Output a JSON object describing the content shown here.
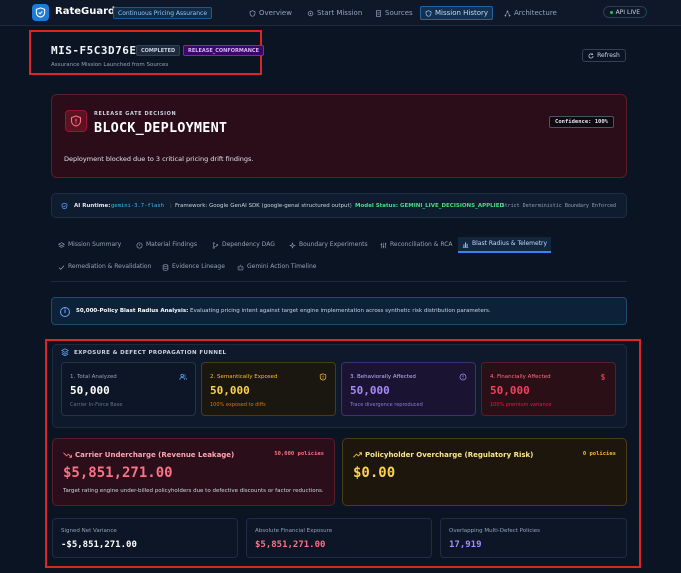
{
  "brand": {
    "name": "RateGuard",
    "ai": "AI",
    "tag": "Continuous Pricing Assurance"
  },
  "nav": [
    {
      "label": "Overview",
      "icon": "shield-icon"
    },
    {
      "label": "Start Mission",
      "icon": "gear-icon"
    },
    {
      "label": "Sources",
      "icon": "document-icon"
    },
    {
      "label": "Mission History",
      "icon": "shield-icon",
      "active": true
    },
    {
      "label": "Architecture",
      "icon": "network-icon"
    }
  ],
  "live": "API LIVE",
  "mission": {
    "id": "MIS-F5C3D76E",
    "status": "COMPLETED",
    "type": "RELEASE_CONFORMANCE",
    "subtitle": "Assurance Mission Launched from Sources"
  },
  "refresh_label": "Refresh",
  "gate": {
    "label": "RELEASE GATE DECISION",
    "decision": "BLOCK_DEPLOYMENT",
    "confidence": "Confidence: 100%",
    "description": "Deployment blocked due to 3 critical pricing drift findings."
  },
  "runtime": {
    "label": "AI Runtime:",
    "model": "gemini-3.7-flash",
    "framework": "Framework: Google GenAI SDK (google-genai structured output)",
    "status": "Model Status: GEMINI_LIVE_DECISIONS_APPLIED",
    "boundary": "Strict Deterministic Boundary Enforced"
  },
  "tabs": [
    {
      "label": "Mission Summary"
    },
    {
      "label": "Material Findings"
    },
    {
      "label": "Dependency DAG"
    },
    {
      "label": "Boundary Experiments"
    },
    {
      "label": "Reconciliation & RCA"
    },
    {
      "label": "Blast Radius & Telemetry",
      "active": true
    },
    {
      "label": "Remediation & Revalidation"
    },
    {
      "label": "Evidence Lineage"
    },
    {
      "label": "Gemini Action Timeline"
    }
  ],
  "info": {
    "bold": "50,000-Policy Blast Radius Analysis:",
    "text": " Evaluating pricing intent against target engine implementation across synthetic risk distribution parameters."
  },
  "funnel": {
    "title": "EXPOSURE & DEFECT PROPAGATION FUNNEL",
    "stages": [
      {
        "label": "1. Total Analyzed",
        "value": "50,000",
        "sub": "Carrier In-Force Base"
      },
      {
        "label": "2. Semantically Exposed",
        "value": "50,000",
        "sub": "100% exposed to diffs"
      },
      {
        "label": "3. Behaviorally Affected",
        "value": "50,000",
        "sub": "Trace divergence reproduced"
      },
      {
        "label": "4. Financially Affected",
        "value": "50,000",
        "sub": "100% premium variance"
      }
    ]
  },
  "impact": {
    "under": {
      "title": "Carrier Undercharge (Revenue Leakage)",
      "count": "50,000 policies",
      "value": "$5,851,271.00",
      "desc": "Target rating engine under-billed policyholders due to defective discounts or factor reductions."
    },
    "over": {
      "title": "Policyholder Overcharge (Regulatory Risk)",
      "count": "0 policies",
      "value": "$0.00"
    }
  },
  "metrics": [
    {
      "label": "Signed Net Variance",
      "value": "-$5,851,271.00"
    },
    {
      "label": "Absolute Financial Exposure",
      "value": "$5,851,271.00"
    },
    {
      "label": "Overlapping Multi-Defect Policies",
      "value": "17,919"
    }
  ]
}
